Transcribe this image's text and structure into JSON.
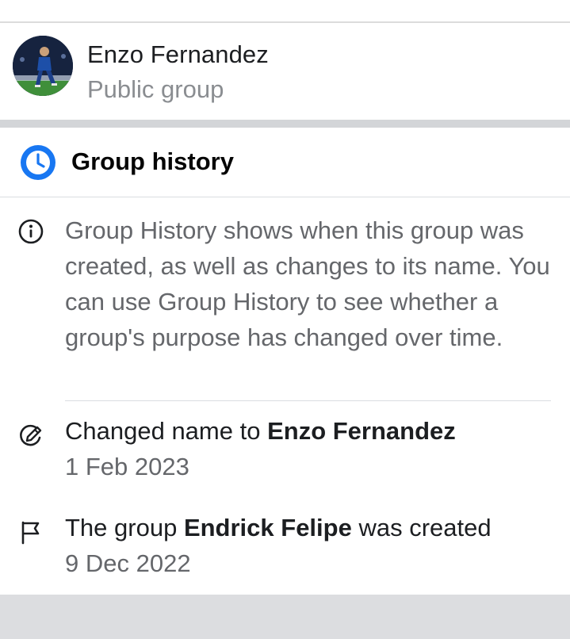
{
  "group": {
    "name": "Enzo Fernandez",
    "type": "Public group"
  },
  "history": {
    "title": "Group history",
    "info_text": "Group History shows when this group was created, as well as changes to its name. You can use Group History to see whether a group's purpose has changed over time.",
    "events": [
      {
        "icon": "rename-icon",
        "prefix": "Changed name to ",
        "bold": "Enzo Fernandez",
        "suffix": "",
        "date": "1 Feb 2023"
      },
      {
        "icon": "flag-icon",
        "prefix": "The group ",
        "bold": "Endrick Felipe",
        "suffix": " was created",
        "date": "9 Dec 2022"
      }
    ]
  },
  "colors": {
    "accent_blue": "#1877f2",
    "secondary_text": "#65676b",
    "divider": "#d3d5d8"
  }
}
